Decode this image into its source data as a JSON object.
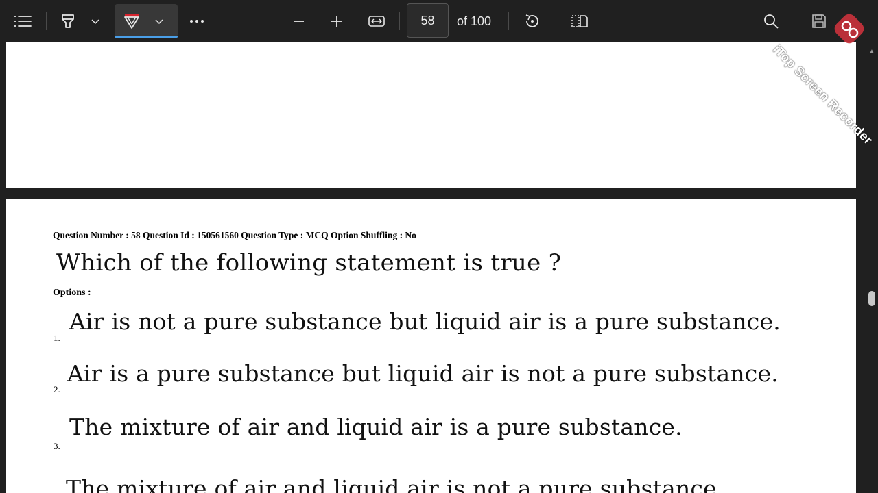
{
  "toolbar": {
    "contents_icon": "list-icon",
    "highlight_icon": "highlighter-icon",
    "draw_icon": "pen-icon",
    "more_icon": "ellipsis-icon",
    "zoom_out_icon": "minus-icon",
    "zoom_in_icon": "plus-icon",
    "fit_icon": "fit-width-icon",
    "page_number": "58",
    "page_total": "of 100",
    "rotate_icon": "rotate-icon",
    "page_view_icon": "page-view-icon",
    "search_icon": "search-icon",
    "save_icon": "save-icon",
    "draw_color": "#d8242e",
    "accent": "#4a9fe8"
  },
  "watermark": {
    "text": "iTop Screen Recorder",
    "logo_color": "#c8323c"
  },
  "document": {
    "question_meta": "Question Number : 58 Question Id : 150561560 Question Type : MCQ Option Shuffling : No",
    "question": "Which of the following statement is true ?",
    "options_label": "Options :",
    "options": [
      {
        "num": "1.",
        "text": "Air is not a pure substance but liquid air is a pure substance."
      },
      {
        "num": "2.",
        "text": "Air is a pure substance but liquid air is not a pure substance."
      },
      {
        "num": "3.",
        "text": "The mixture of air and liquid air is a pure substance."
      },
      {
        "num": "",
        "text": "The mixture of air and liquid air is not a pure substance."
      }
    ]
  }
}
